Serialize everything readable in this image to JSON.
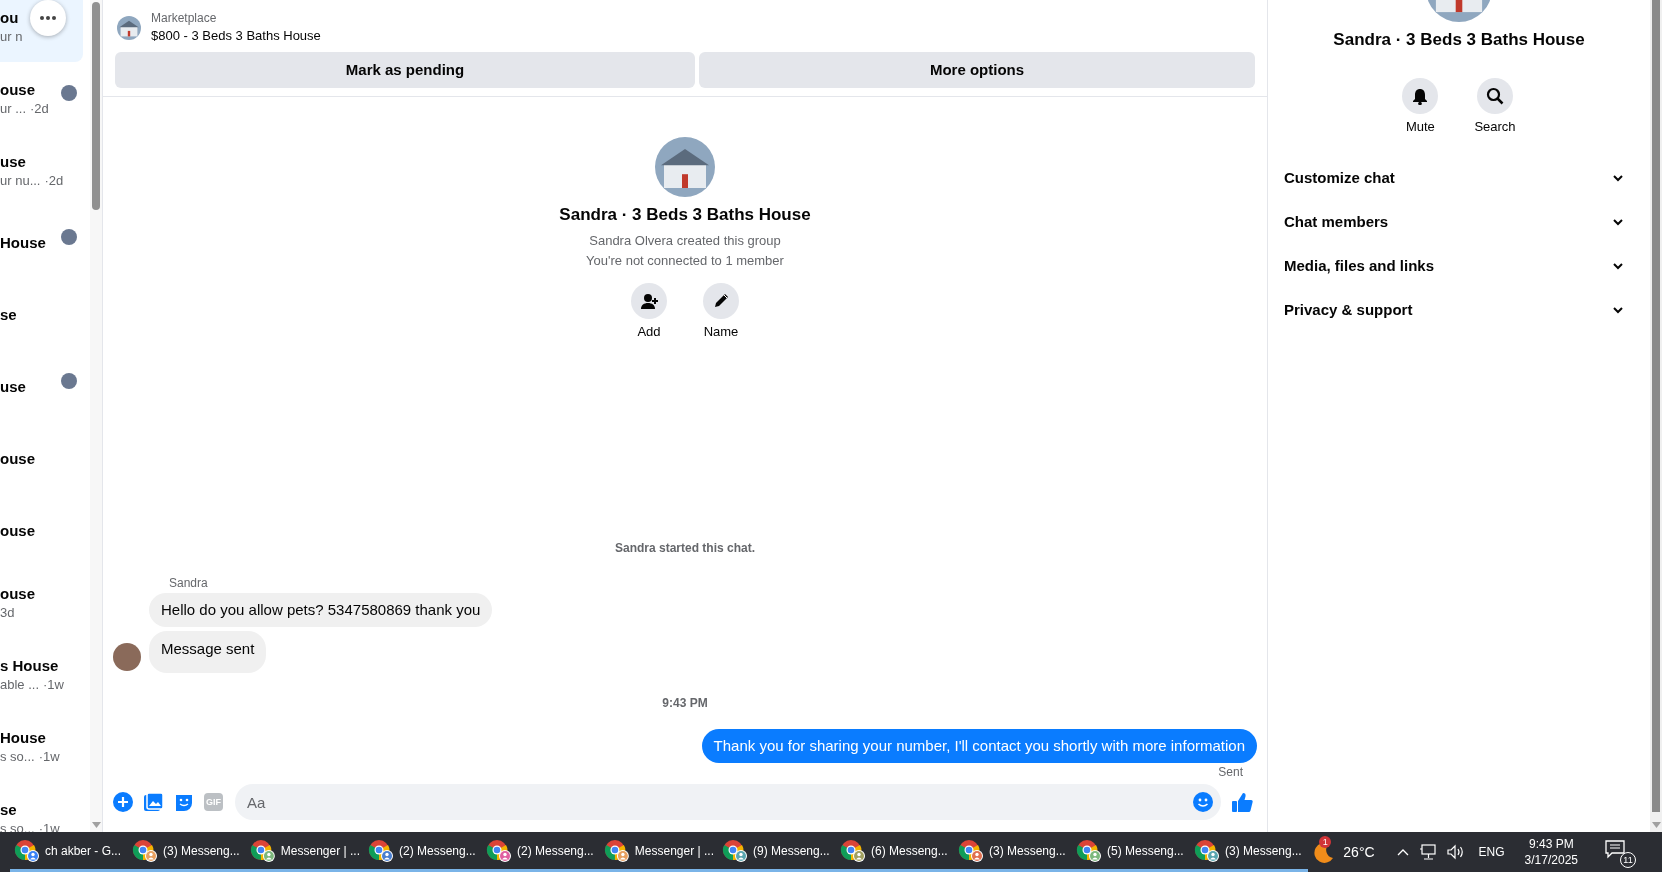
{
  "conversation_list": {
    "items": [
      {
        "title": "ou",
        "subtitle": "ur n",
        "avatar": false,
        "selected": true
      },
      {
        "title": "ouse",
        "subtitle": "ur ...",
        "time": "·2d",
        "avatar": true,
        "selected": false
      },
      {
        "title": "use",
        "subtitle": "ur nu...",
        "time": "·2d",
        "avatar": false,
        "selected": false
      },
      {
        "title": "House",
        "avatar": true,
        "selected": false
      },
      {
        "title": "se",
        "avatar": false,
        "selected": false
      },
      {
        "title": "use",
        "avatar": true,
        "selected": false
      },
      {
        "title": "ouse",
        "avatar": false,
        "selected": false
      },
      {
        "title": "ouse",
        "avatar": false,
        "selected": false
      },
      {
        "title": "ouse",
        "subtitle": "3d",
        "avatar": false,
        "selected": false
      },
      {
        "title": "s House",
        "subtitle": "able ...",
        "time": "·1w",
        "avatar": false,
        "selected": false
      },
      {
        "title": "House",
        "subtitle": "s so...",
        "time": "·1w",
        "avatar": false,
        "selected": false
      },
      {
        "title": "se",
        "subtitle": "s so...",
        "time": "·1w",
        "avatar": false,
        "selected": false
      }
    ]
  },
  "chat": {
    "listing": {
      "label": "Marketplace",
      "title": "$800 - 3 Beds 3 Baths House"
    },
    "actions": [
      "Mark as pending",
      "More options"
    ],
    "intro": {
      "title": "Sandra · 3 Beds 3 Baths House",
      "lines": [
        "Sandra Olvera created this group",
        "You're not connected to 1 member"
      ],
      "actions": [
        {
          "kind": "add",
          "label": "Add"
        },
        {
          "kind": "name",
          "label": "Name"
        }
      ]
    },
    "messages": [
      {
        "kind": "system",
        "text": "Sandra started this chat."
      },
      {
        "kind": "sender",
        "text": "Sandra"
      },
      {
        "kind": "incoming",
        "text": "Hello do you allow pets? 5347580869 thank you",
        "avatar": false
      },
      {
        "kind": "incoming",
        "text": "Message sent",
        "avatar": true
      },
      {
        "kind": "time",
        "text": "9:43 PM"
      },
      {
        "kind": "outgoing",
        "text": "Thank you for sharing your number, I'll contact you shortly with more information"
      },
      {
        "kind": "status",
        "text": "Sent"
      }
    ],
    "composer": {
      "gif_label": "GIF",
      "placeholder": "Aa"
    }
  },
  "details": {
    "title": "Sandra · 3 Beds 3 Baths House",
    "actions": [
      {
        "kind": "mute",
        "label": "Mute"
      },
      {
        "kind": "search",
        "label": "Search"
      }
    ],
    "sections": [
      {
        "label": "Customize chat",
        "expanded": false
      },
      {
        "label": "Chat members",
        "expanded": false
      },
      {
        "label": "Media, files and links",
        "expanded": false
      },
      {
        "label": "Privacy & support",
        "expanded": false
      }
    ]
  },
  "taskbar": {
    "tasks": [
      {
        "label": "ch akber - G...",
        "color": "#3b82f6"
      },
      {
        "label": "(3) Messeng...",
        "color": "#e8a060"
      },
      {
        "label": "Messenger | ...",
        "color": "#7cb87c"
      },
      {
        "label": "(2) Messeng...",
        "color": "#4a7fd0"
      },
      {
        "label": "(2) Messeng...",
        "color": "#e060a0"
      },
      {
        "label": "Messenger | ...",
        "color": "#e8a060"
      },
      {
        "label": "(9) Messeng...",
        "color": "#5aa6b0"
      },
      {
        "label": "(6) Messeng...",
        "color": "#a0a060"
      },
      {
        "label": "(3) Messeng...",
        "color": "#e07050"
      },
      {
        "label": "(5) Messeng...",
        "color": "#7cb87c"
      },
      {
        "label": "(3) Messeng...",
        "color": "#5aa6b0"
      }
    ],
    "weather": {
      "temperature": "26°C",
      "badge": "1"
    },
    "language": "ENG",
    "time": "9:43 PM",
    "date": "3/17/2025",
    "notifications": "11"
  }
}
